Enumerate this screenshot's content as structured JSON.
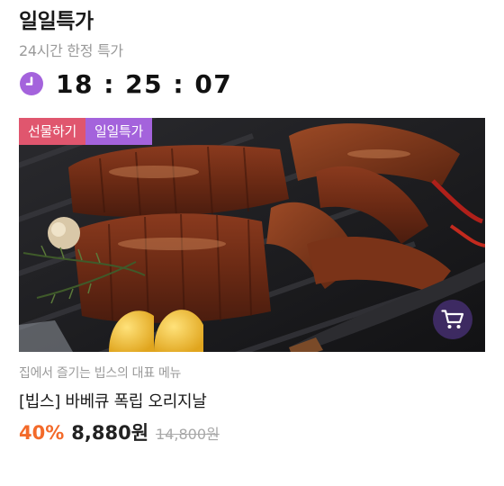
{
  "section": {
    "title": "일일특가",
    "subtitle": "24시간 한정 특가"
  },
  "timer": {
    "icon": "clock-icon",
    "text": "18 : 25 : 07",
    "icon_color": "#a463dc"
  },
  "product": {
    "badges": [
      {
        "label": "선물하기",
        "color": "#e0566e"
      },
      {
        "label": "일일특가",
        "color": "#a463dc"
      }
    ],
    "cart_icon": "cart-icon",
    "description": "집에서 즐기는 빕스의 대표 메뉴",
    "name": "[빕스] 바베큐 폭립 오리지날",
    "discount": "40%",
    "sale_price": "8,880원",
    "original_price": "14,800원",
    "discount_color": "#f36a2a"
  }
}
